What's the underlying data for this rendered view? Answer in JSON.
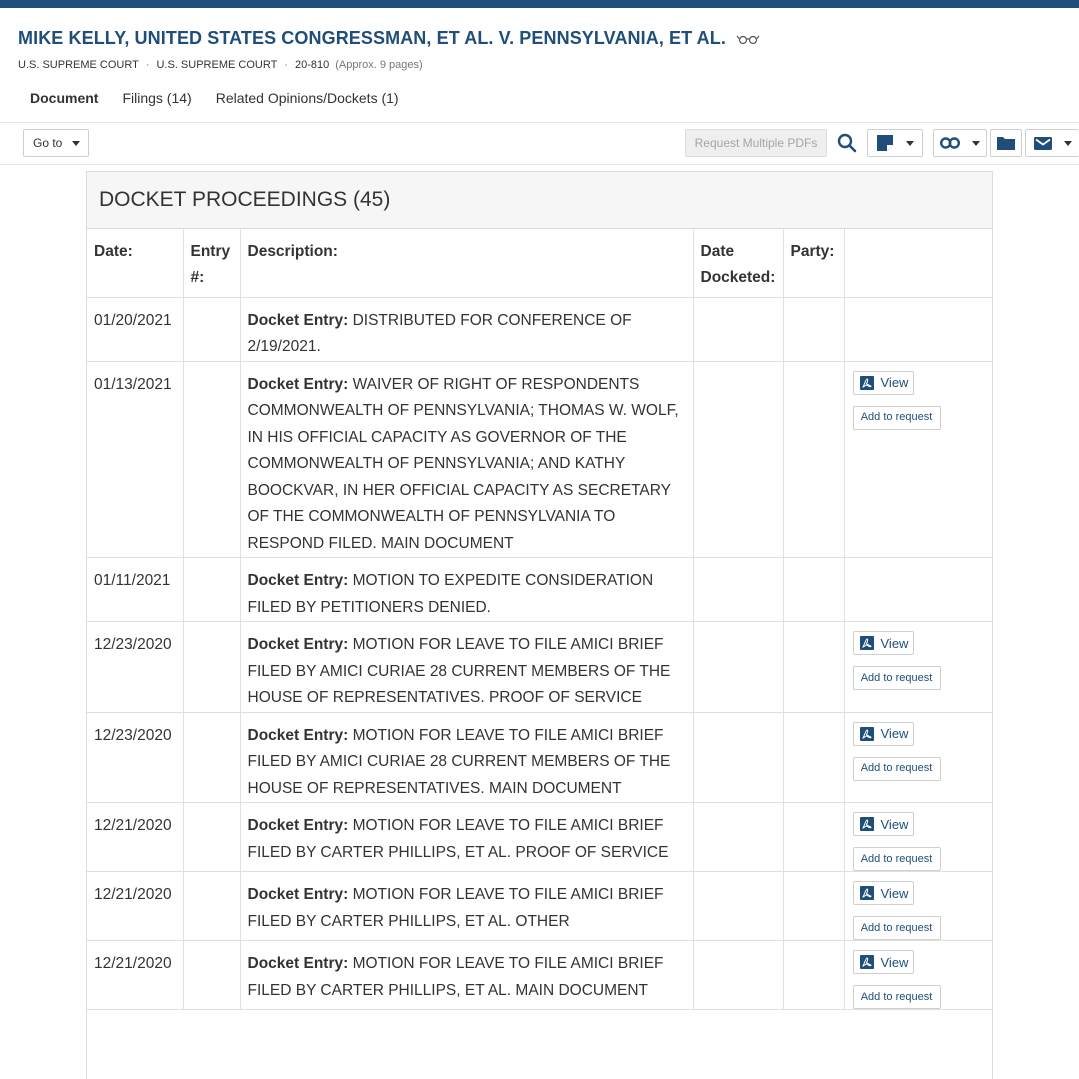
{
  "header": {
    "case_title": "MIKE KELLY, UNITED STATES CONGRESSMAN, ET AL. V. PENNSYLVANIA, ET AL.",
    "court_1": "U.S. SUPREME COURT",
    "court_2": "U.S. SUPREME COURT",
    "docket_number": "20-810",
    "pages": "(Approx. 9 pages)"
  },
  "tabs": [
    {
      "label": "Document",
      "active": true
    },
    {
      "label": "Filings (14)",
      "active": false
    },
    {
      "label": "Related Opinions/Dockets (1)",
      "active": false
    }
  ],
  "toolbar": {
    "goto_label": "Go to",
    "request_pdfs_label": "Request Multiple PDFs"
  },
  "docket": {
    "title": "DOCKET PROCEEDINGS (45)",
    "columns": {
      "date": "Date:",
      "entry": "Entry #:",
      "description": "Description:",
      "date_docketed": "Date Docketed:",
      "party": "Party:"
    },
    "entry_prefix": "Docket Entry:",
    "view_label": "View",
    "add_label": "Add to request",
    "rows": [
      {
        "date": "01/20/2021",
        "entry": "",
        "description": "DISTRIBUTED FOR CONFERENCE OF 2/19/2021.",
        "date_docketed": "",
        "party": "",
        "has_pdf": false
      },
      {
        "date": "01/13/2021",
        "entry": "",
        "description": "WAIVER OF RIGHT OF RESPONDENTS COMMONWEALTH OF PENNSYLVANIA; THOMAS W. WOLF, IN HIS OFFICIAL CAPACITY AS GOVERNOR OF THE COMMONWEALTH OF PENNSYLVANIA; AND KATHY BOOCKVAR, IN HER OFFICIAL CAPACITY AS SECRETARY OF THE COMMONWEALTH OF PENNSYLVANIA TO RESPOND FILED. MAIN DOCUMENT",
        "date_docketed": "",
        "party": "",
        "has_pdf": true
      },
      {
        "date": "01/11/2021",
        "entry": "",
        "description": "MOTION TO EXPEDITE CONSIDERATION FILED BY PETITIONERS DENIED.",
        "date_docketed": "",
        "party": "",
        "has_pdf": false
      },
      {
        "date": "12/23/2020",
        "entry": "",
        "description": "MOTION FOR LEAVE TO FILE AMICI BRIEF FILED BY AMICI CURIAE 28 CURRENT MEMBERS OF THE HOUSE OF REPRESENTATIVES. PROOF OF SERVICE",
        "date_docketed": "",
        "party": "",
        "has_pdf": true
      },
      {
        "date": "12/23/2020",
        "entry": "",
        "description": "MOTION FOR LEAVE TO FILE AMICI BRIEF FILED BY AMICI CURIAE 28 CURRENT MEMBERS OF THE HOUSE OF REPRESENTATIVES. MAIN DOCUMENT",
        "date_docketed": "",
        "party": "",
        "has_pdf": true
      },
      {
        "date": "12/21/2020",
        "entry": "",
        "description": "MOTION FOR LEAVE TO FILE AMICI BRIEF FILED BY CARTER PHILLIPS, ET AL. PROOF OF SERVICE",
        "date_docketed": "",
        "party": "",
        "has_pdf": true
      },
      {
        "date": "12/21/2020",
        "entry": "",
        "description": "MOTION FOR LEAVE TO FILE AMICI BRIEF FILED BY CARTER PHILLIPS, ET AL. OTHER",
        "date_docketed": "",
        "party": "",
        "has_pdf": true
      },
      {
        "date": "12/21/2020",
        "entry": "",
        "description": "MOTION FOR LEAVE TO FILE AMICI BRIEF FILED BY CARTER PHILLIPS, ET AL. MAIN DOCUMENT",
        "date_docketed": "",
        "party": "",
        "has_pdf": true
      }
    ]
  },
  "icons": {
    "glasses": "glasses-icon",
    "search": "search-icon",
    "note": "note-icon",
    "link": "link-icon",
    "folder": "folder-icon",
    "email": "email-icon",
    "pdf": "pdf-icon"
  },
  "colors": {
    "brand": "#1f4e79",
    "text": "#333333",
    "muted": "#a5a5a5"
  }
}
